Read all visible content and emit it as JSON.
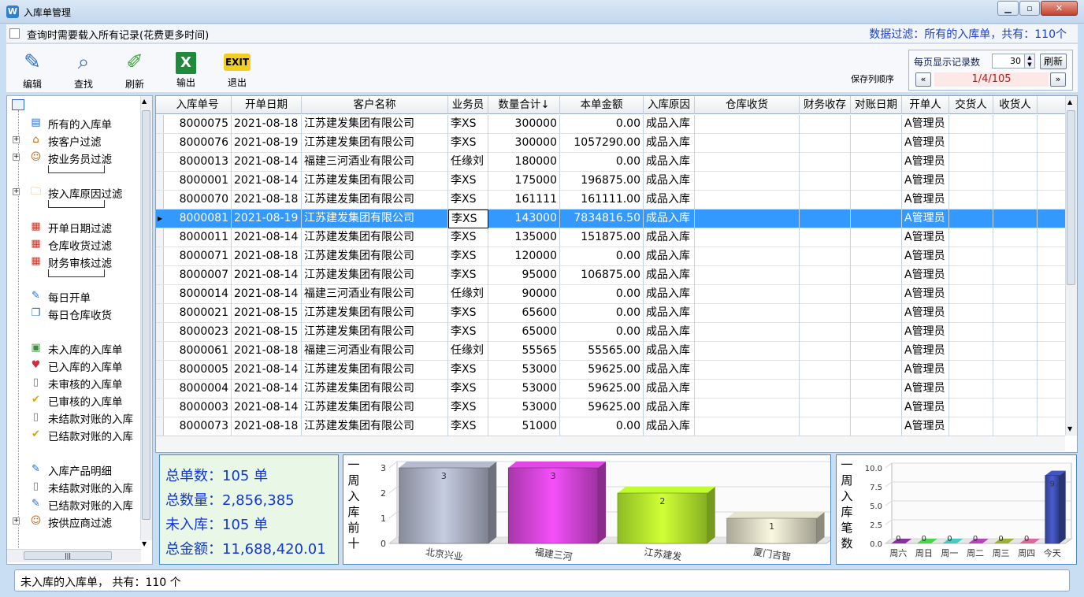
{
  "window": {
    "title": "入库单管理",
    "app_icon": "W"
  },
  "topbar": {
    "load_all_label": "查询时需要载入所有记录(花费更多时间)",
    "filter_text": "数据过滤：所有的入库单，共有：110个"
  },
  "toolbar": {
    "edit": "编辑",
    "find": "查找",
    "refresh": "刷新",
    "export": "输出",
    "exit": "退出",
    "save_column_order": "保存列顺序"
  },
  "pager": {
    "per_page_label": "每页显示记录数",
    "per_page_value": "30",
    "refresh_label": "刷新",
    "page_info": "1/4/105",
    "prev": "«",
    "next": "»"
  },
  "tree": {
    "items": [
      {
        "label": "所有的入库单",
        "icon": "list-icon",
        "expandable": false
      },
      {
        "label": "按客户过滤",
        "icon": "house-icon",
        "expandable": true
      },
      {
        "label": "按业务员过滤",
        "icon": "person-icon",
        "expandable": true
      },
      {
        "label": "按入库原因过滤",
        "icon": "folder-doc-icon",
        "expandable": true
      },
      {
        "label": "开单日期过滤",
        "icon": "calendar-icon",
        "expandable": false
      },
      {
        "label": "仓库收货过滤",
        "icon": "calendar-icon",
        "expandable": false
      },
      {
        "label": "财务审核过滤",
        "icon": "calendar-icon",
        "expandable": false
      },
      {
        "label": "每日开单",
        "icon": "edit-doc-icon",
        "expandable": false
      },
      {
        "label": "每日仓库收货",
        "icon": "copy-doc-icon",
        "expandable": false
      },
      {
        "label": "未入库的入库单",
        "icon": "pending-icon",
        "expandable": false
      },
      {
        "label": "已入库的入库单",
        "icon": "heart-box-icon",
        "expandable": false
      },
      {
        "label": "未审核的入库单",
        "icon": "doc-icon",
        "expandable": false
      },
      {
        "label": "已审核的入库单",
        "icon": "check-doc-icon",
        "expandable": false
      },
      {
        "label": "未结款对账的入库",
        "icon": "doc-icon",
        "expandable": false
      },
      {
        "label": "已结款对账的入库",
        "icon": "check-doc-icon",
        "expandable": false
      },
      {
        "label": "入库产品明细",
        "icon": "edit-doc-icon",
        "expandable": false
      },
      {
        "label": "未结款对账的入库",
        "icon": "doc-icon",
        "expandable": false
      },
      {
        "label": "已结款对账的入库",
        "icon": "edit-doc-icon",
        "expandable": false
      },
      {
        "label": "按供应商过滤",
        "icon": "person-icon",
        "expandable": true
      }
    ]
  },
  "grid": {
    "columns": [
      "入库单号",
      "开单日期",
      "客户名称",
      "业务员",
      "数量合计↓",
      "本单金额",
      "入库原因",
      "仓库收货",
      "财务收存",
      "对账日期",
      "开单人",
      "交货人",
      "收货人"
    ],
    "selected_index": 5,
    "rows": [
      [
        "8000075",
        "2021-08-18",
        "江苏建发集团有限公司",
        "李XS",
        "300000",
        "0.00",
        "成品入库",
        "",
        "",
        "",
        "A管理员",
        "",
        ""
      ],
      [
        "8000076",
        "2021-08-19",
        "江苏建发集团有限公司",
        "李XS",
        "300000",
        "1057290.00",
        "成品入库",
        "",
        "",
        "",
        "A管理员",
        "",
        ""
      ],
      [
        "8000013",
        "2021-08-14",
        "福建三河酒业有限公司",
        "任缘刘",
        "180000",
        "0.00",
        "成品入库",
        "",
        "",
        "",
        "A管理员",
        "",
        ""
      ],
      [
        "8000001",
        "2021-08-14",
        "江苏建发集团有限公司",
        "李XS",
        "175000",
        "196875.00",
        "成品入库",
        "",
        "",
        "",
        "A管理员",
        "",
        ""
      ],
      [
        "8000070",
        "2021-08-18",
        "江苏建发集团有限公司",
        "李XS",
        "161111",
        "161111.00",
        "成品入库",
        "",
        "",
        "",
        "A管理员",
        "",
        ""
      ],
      [
        "8000081",
        "2021-08-19",
        "江苏建发集团有限公司",
        "李XS",
        "143000",
        "7834816.50",
        "成品入库",
        "",
        "",
        "",
        "A管理员",
        "",
        ""
      ],
      [
        "8000011",
        "2021-08-14",
        "江苏建发集团有限公司",
        "李XS",
        "135000",
        "151875.00",
        "成品入库",
        "",
        "",
        "",
        "A管理员",
        "",
        ""
      ],
      [
        "8000071",
        "2021-08-18",
        "江苏建发集团有限公司",
        "李XS",
        "120000",
        "0.00",
        "成品入库",
        "",
        "",
        "",
        "A管理员",
        "",
        ""
      ],
      [
        "8000007",
        "2021-08-14",
        "江苏建发集团有限公司",
        "李XS",
        "95000",
        "106875.00",
        "成品入库",
        "",
        "",
        "",
        "A管理员",
        "",
        ""
      ],
      [
        "8000014",
        "2021-08-14",
        "福建三河酒业有限公司",
        "任缘刘",
        "90000",
        "0.00",
        "成品入库",
        "",
        "",
        "",
        "A管理员",
        "",
        ""
      ],
      [
        "8000021",
        "2021-08-15",
        "江苏建发集团有限公司",
        "李XS",
        "65600",
        "0.00",
        "成品入库",
        "",
        "",
        "",
        "A管理员",
        "",
        ""
      ],
      [
        "8000023",
        "2021-08-15",
        "江苏建发集团有限公司",
        "李XS",
        "65000",
        "0.00",
        "成品入库",
        "",
        "",
        "",
        "A管理员",
        "",
        ""
      ],
      [
        "8000061",
        "2021-08-18",
        "福建三河酒业有限公司",
        "任缘刘",
        "55565",
        "55565.00",
        "成品入库",
        "",
        "",
        "",
        "A管理员",
        "",
        ""
      ],
      [
        "8000005",
        "2021-08-14",
        "江苏建发集团有限公司",
        "李XS",
        "53000",
        "59625.00",
        "成品入库",
        "",
        "",
        "",
        "A管理员",
        "",
        ""
      ],
      [
        "8000004",
        "2021-08-14",
        "江苏建发集团有限公司",
        "李XS",
        "53000",
        "59625.00",
        "成品入库",
        "",
        "",
        "",
        "A管理员",
        "",
        ""
      ],
      [
        "8000003",
        "2021-08-14",
        "江苏建发集团有限公司",
        "李XS",
        "53000",
        "59625.00",
        "成品入库",
        "",
        "",
        "",
        "A管理员",
        "",
        ""
      ],
      [
        "8000073",
        "2021-08-18",
        "江苏建发集团有限公司",
        "李XS",
        "51000",
        "0.00",
        "成品入库",
        "",
        "",
        "",
        "A管理员",
        "",
        ""
      ]
    ]
  },
  "summary": {
    "total_orders": "总单数：105 单",
    "total_qty": "总数量：2,856,385",
    "not_stocked": "未入库：105 单",
    "total_amount": "总金额：11,688,420.01"
  },
  "chart_data": [
    {
      "type": "bar",
      "title": "一周入库前十",
      "categories": [
        "北京兴业",
        "福建三河",
        "江苏建发",
        "厦门吉智"
      ],
      "values": [
        3,
        3,
        2,
        1
      ],
      "colors": [
        "#9ea3b4",
        "#c43fc8",
        "#a7dc2a",
        "#c8c6b2"
      ],
      "ylim": [
        0,
        3
      ],
      "yticks": [
        "0",
        "1",
        "2",
        "3"
      ],
      "grid": true
    },
    {
      "type": "bar",
      "title": "一周入库笔数",
      "categories": [
        "周六",
        "周日",
        "周一",
        "周二",
        "周三",
        "周四",
        "今天"
      ],
      "values": [
        0,
        0,
        0,
        0,
        0,
        0,
        9
      ],
      "colors": [
        "#7a2a8a",
        "#3dbb3d",
        "#3cb0a8",
        "#a03aa3",
        "#8a9a2a",
        "#c05a8a",
        "#3a4aa8"
      ],
      "ylim": [
        0,
        10
      ],
      "yticks": [
        "0.0",
        "2.5",
        "5.0",
        "7.5",
        "10.0"
      ],
      "grid": true
    }
  ],
  "status": {
    "text": "未入库的入库单，  共有：110 个"
  }
}
